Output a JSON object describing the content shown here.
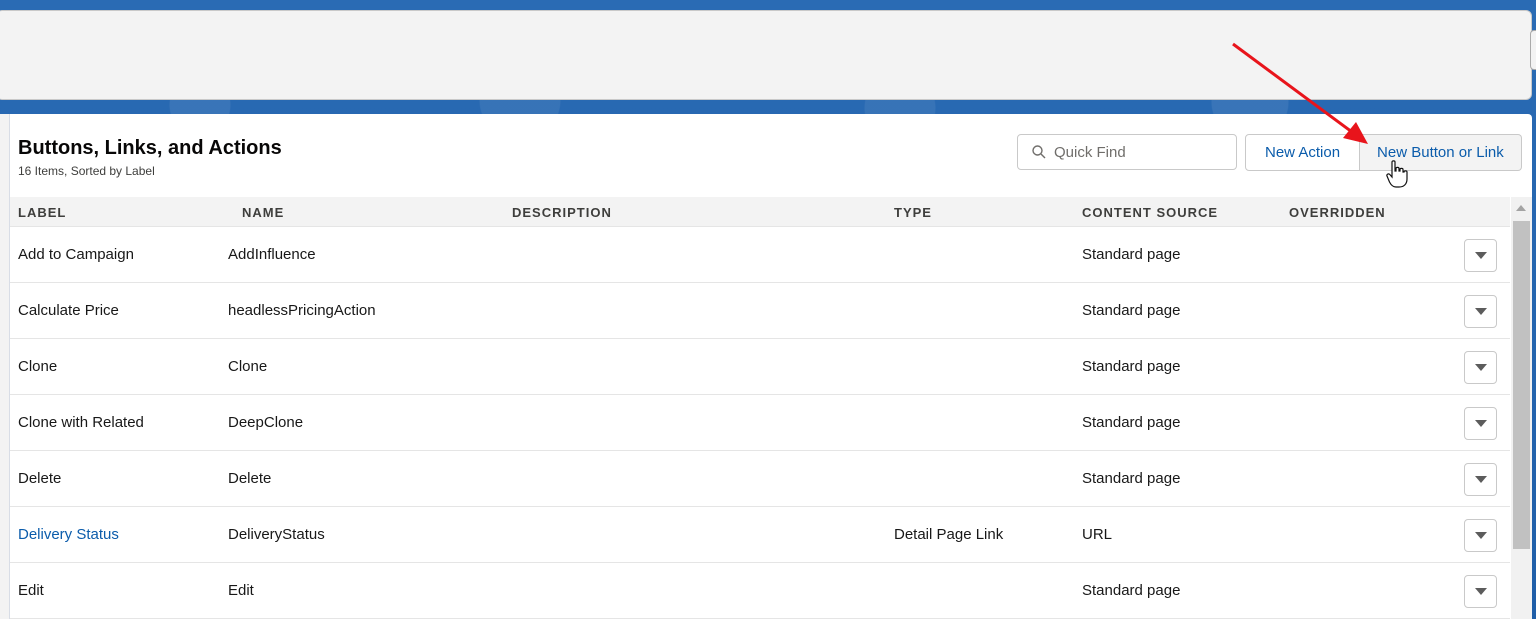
{
  "page": {
    "title": "Buttons, Links, and Actions",
    "subtitle": "16 Items, Sorted by Label"
  },
  "toolbar": {
    "search_placeholder": "Quick Find",
    "new_action_label": "New Action",
    "new_button_label": "New Button or Link"
  },
  "table": {
    "headers": {
      "label": "LABEL",
      "name": "NAME",
      "description": "DESCRIPTION",
      "type": "TYPE",
      "content_source": "CONTENT SOURCE",
      "overridden": "OVERRIDDEN"
    },
    "rows": [
      {
        "label": "Add to Campaign",
        "name": "AddInfluence",
        "description": "",
        "type": "",
        "content_source": "Standard page",
        "overridden": "",
        "is_link": false
      },
      {
        "label": "Calculate Price",
        "name": "headlessPricingAction",
        "description": "",
        "type": "",
        "content_source": "Standard page",
        "overridden": "",
        "is_link": false
      },
      {
        "label": "Clone",
        "name": "Clone",
        "description": "",
        "type": "",
        "content_source": "Standard page",
        "overridden": "",
        "is_link": false
      },
      {
        "label": "Clone with Related",
        "name": "DeepClone",
        "description": "",
        "type": "",
        "content_source": "Standard page",
        "overridden": "",
        "is_link": false
      },
      {
        "label": "Delete",
        "name": "Delete",
        "description": "",
        "type": "",
        "content_source": "Standard page",
        "overridden": "",
        "is_link": false
      },
      {
        "label": "Delivery Status",
        "name": "DeliveryStatus",
        "description": "",
        "type": "Detail Page Link",
        "content_source": "URL",
        "overridden": "",
        "is_link": true
      },
      {
        "label": "Edit",
        "name": "Edit",
        "description": "",
        "type": "",
        "content_source": "Standard page",
        "overridden": "",
        "is_link": false
      }
    ]
  },
  "colors": {
    "link": "#0b5cab",
    "annotation_arrow": "#e8141b",
    "brand_band": "#1f5ea8"
  },
  "icons": {
    "search": "search-icon",
    "row_menu": "chevron-down-icon",
    "cursor": "hand-pointer-icon",
    "annotation": "red-arrow-icon"
  }
}
